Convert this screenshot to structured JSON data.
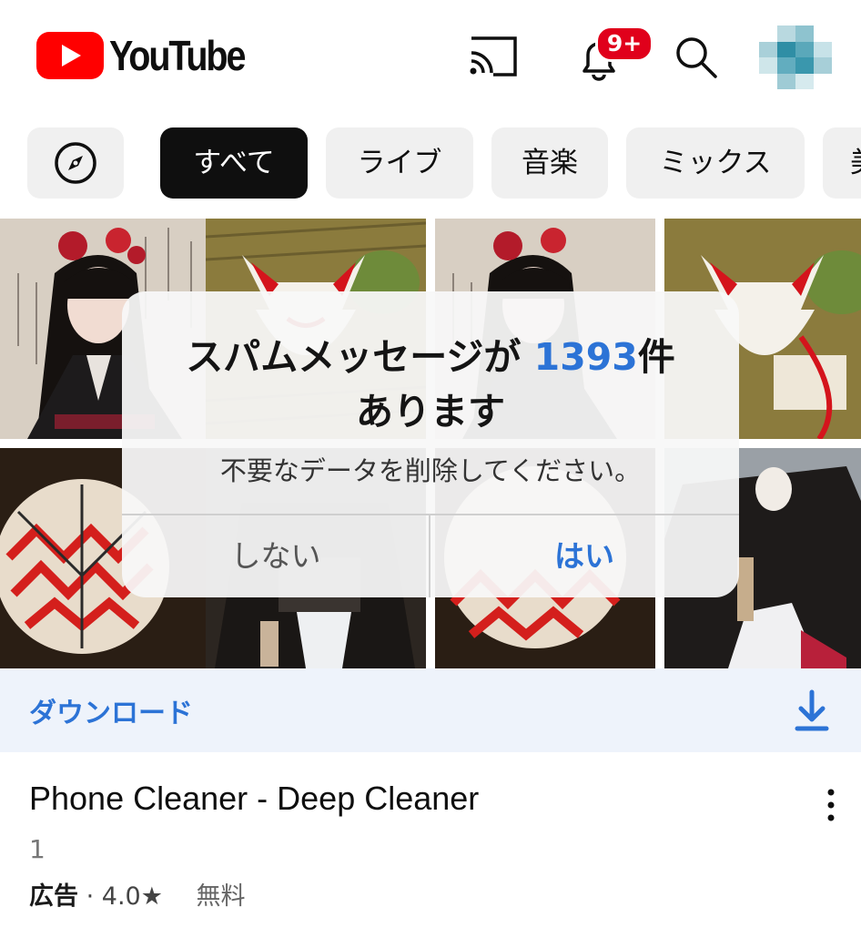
{
  "header": {
    "logo_text": "YouTube",
    "notification_badge": "9+"
  },
  "chips": [
    "すべて",
    "ライブ",
    "音楽",
    "ミックス",
    "美"
  ],
  "dialog": {
    "title_prefix": "スパムメッセージが",
    "count": "1393",
    "title_suffix": "件",
    "title_line2": "あります",
    "message": "不要なデータを削除してください。",
    "cancel_label": "しない",
    "confirm_label": "はい"
  },
  "download_bar": {
    "label": "ダウンロード"
  },
  "app": {
    "title": "Phone Cleaner - Deep Cleaner",
    "subtitle": "1",
    "ad_label": "広告",
    "separator": "·",
    "rating": "4.0★",
    "price": "無料"
  },
  "colors": {
    "brand_red": "#ff0000",
    "accent_blue": "#2c73d6",
    "badge_red": "#e0001b"
  }
}
